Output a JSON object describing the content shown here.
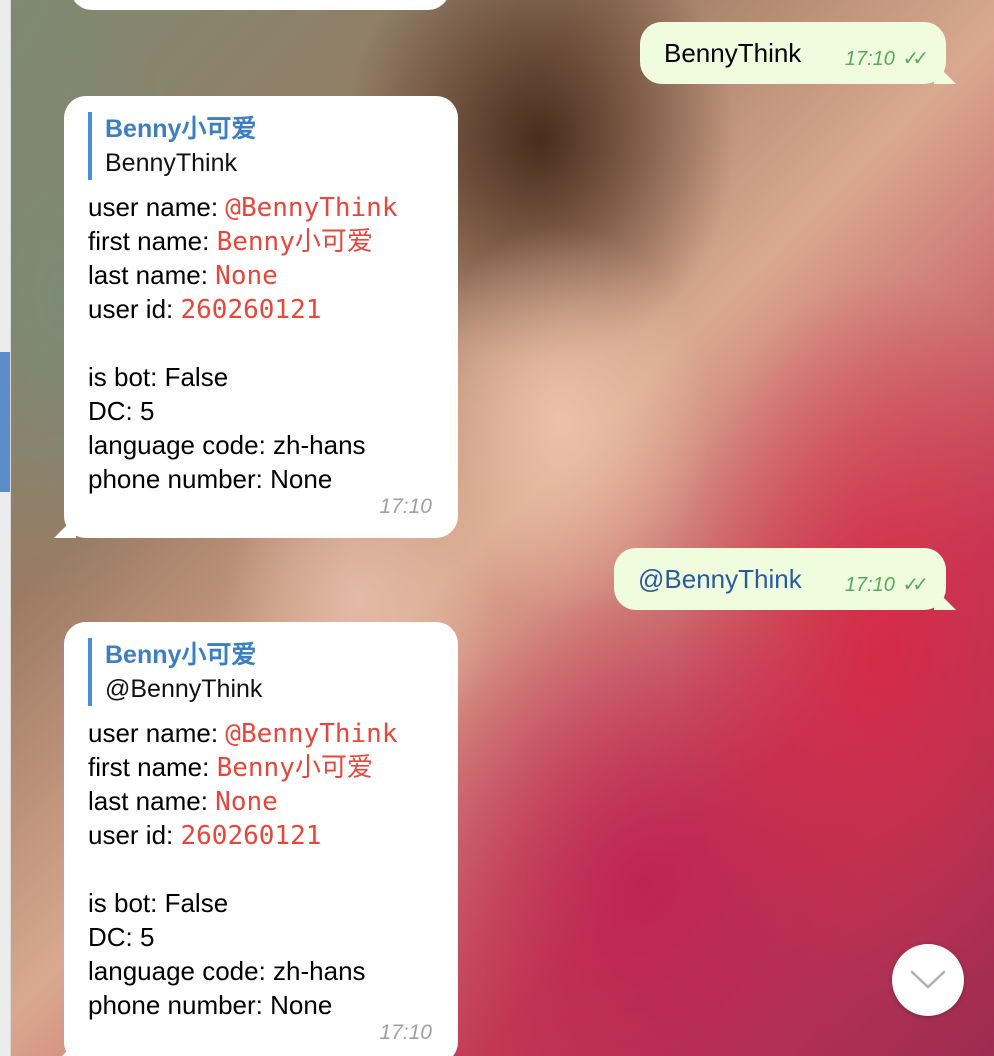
{
  "messages": [
    {
      "direction": "outgoing",
      "text": "BennyThink",
      "time": "17:10",
      "status": "read"
    },
    {
      "direction": "incoming",
      "reply": {
        "name": "Benny小可爱",
        "text": "BennyThink"
      },
      "lines": [
        {
          "label": "user name: ",
          "value": "@BennyThink"
        },
        {
          "label": "first name: ",
          "value": "Benny小可爱"
        },
        {
          "label": "last name: ",
          "value": "None"
        },
        {
          "label": "user id: ",
          "value": "260260121"
        },
        {
          "label": "is bot: False"
        },
        {
          "label": "DC: 5"
        },
        {
          "label": "language code: zh-hans"
        },
        {
          "label": "phone number: None"
        }
      ],
      "time": "17:10"
    },
    {
      "direction": "outgoing",
      "text": "@BennyThink",
      "time": "17:10",
      "status": "read"
    },
    {
      "direction": "incoming",
      "reply": {
        "name": "Benny小可爱",
        "text": "@BennyThink"
      },
      "lines": [
        {
          "label": "user name: ",
          "value": "@BennyThink"
        },
        {
          "label": "first name: ",
          "value": "Benny小可爱"
        },
        {
          "label": "last name: ",
          "value": "None"
        },
        {
          "label": "user id: ",
          "value": "260260121"
        },
        {
          "label": "is bot: False"
        },
        {
          "label": "DC: 5"
        },
        {
          "label": "language code: zh-hans"
        },
        {
          "label": "phone number: None"
        }
      ],
      "time": "17:10"
    }
  ],
  "icons": {
    "read_receipt": "double-check-icon",
    "scroll_down": "chevron-down-icon"
  },
  "colors": {
    "outgoing_bubble": "#effdde",
    "incoming_bubble": "#ffffff",
    "reply_name": "#3c7fc1",
    "value_text": "#e8453c",
    "read_check": "#5aa95a"
  }
}
